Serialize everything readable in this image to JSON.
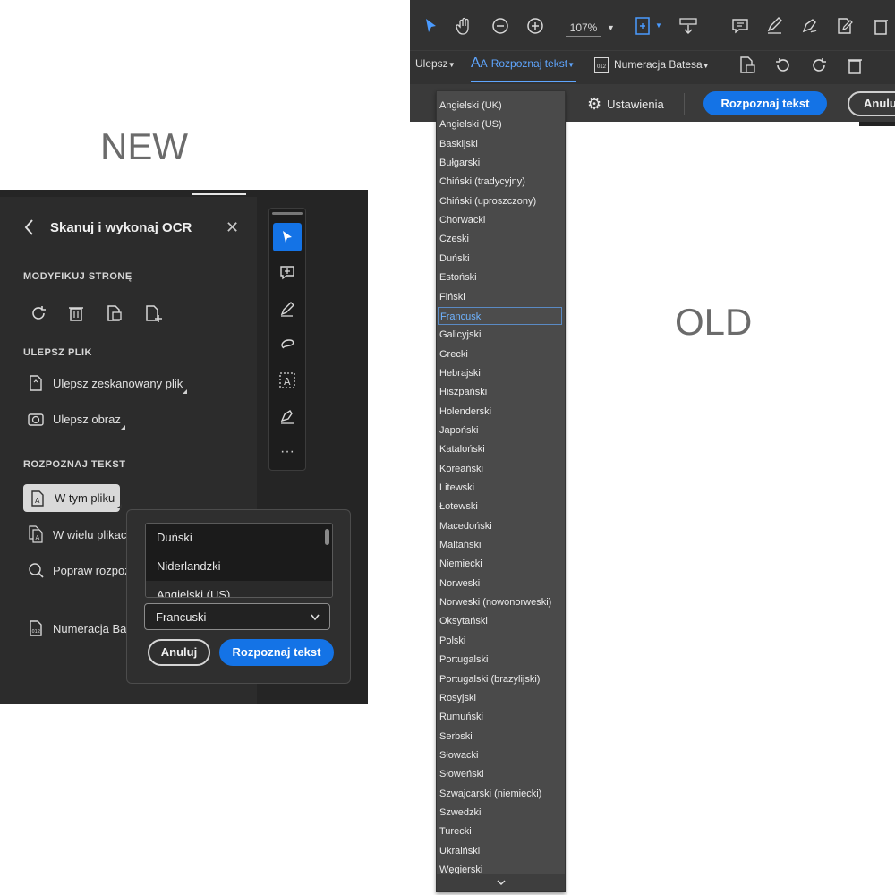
{
  "labels": {
    "new": "NEW",
    "old": "OLD"
  },
  "new_panel": {
    "title": "Skanuj i wykonaj OCR",
    "sections": {
      "modify_page": "MODYFIKUJ STRONĘ",
      "improve_file": "ULEPSZ PLIK",
      "recognize_text": "ROZPOZNAJ TEKST"
    },
    "tools": {
      "enhance_scan": "Ulepsz zeskanowany plik",
      "enhance_image": "Ulepsz obraz",
      "in_this_file": "W tym pliku",
      "in_many_files": "W wielu plikac",
      "fix_recognition": "Popraw rozpoz",
      "bates": "Numeracja Ba"
    },
    "popover": {
      "list_items": [
        "Duński",
        "Niderlandzki",
        "Angielski (US)"
      ],
      "selected_language": "Francuski",
      "cancel": "Anuluj",
      "recognize": "Rozpoznaj tekst"
    }
  },
  "old_panel": {
    "zoom": "107%",
    "tabs": {
      "improve": "Ulepsz",
      "recognize_text": "Rozpoznaj tekst",
      "bates": "Numeracja Batesa"
    },
    "settings": "Ustawienia",
    "recognize_button": "Rozpoznaj tekst",
    "cancel_button": "Anulu",
    "languages": [
      "Angielski (UK)",
      "Angielski (US)",
      "Baskijski",
      "Bułgarski",
      "Chiński (tradycyjny)",
      "Chiński (uproszczony)",
      "Chorwacki",
      "Czeski",
      "Duński",
      "Estoński",
      "Fiński",
      "Francuski",
      "Galicyjski",
      "Grecki",
      "Hebrajski",
      "Hiszpański",
      "Holenderski",
      "Japoński",
      "Kataloński",
      "Koreański",
      "Litewski",
      "Łotewski",
      "Macedoński",
      "Maltański",
      "Niemiecki",
      "Norweski",
      "Norweski (nowonorweski)",
      "Oksytański",
      "Polski",
      "Portugalski",
      "Portugalski (brazylijski)",
      "Rosyjski",
      "Rumuński",
      "Serbski",
      "Słowacki",
      "Słoweński",
      "Szwajcarski (niemiecki)",
      "Szwedzki",
      "Turecki",
      "Ukraiński",
      "Węgierski"
    ],
    "selected_language": "Francuski"
  },
  "colors": {
    "accent": "#1473e6",
    "panel_dark": "#252525",
    "toolbar_old": "#323232"
  }
}
